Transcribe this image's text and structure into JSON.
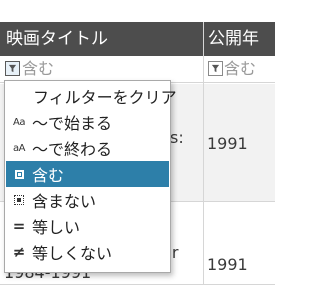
{
  "grid": {
    "columns": [
      {
        "header": "映画タイトル",
        "filter_placeholder": "含む"
      },
      {
        "header": "公開年",
        "filter_placeholder": "含む"
      }
    ],
    "rows": [
      {
        "title_fragment": "s:",
        "year": "1991"
      },
      {
        "title_fragment": "er",
        "title_fragment_2": "1984-1991",
        "year": "1991"
      }
    ]
  },
  "filter_menu": {
    "items": [
      {
        "label": "フィルターをクリア",
        "icon": "",
        "selected": false
      },
      {
        "label": "〜で始まる",
        "icon": "Aa",
        "selected": false
      },
      {
        "label": "〜で終わる",
        "icon": "aA",
        "selected": false
      },
      {
        "label": "含む",
        "icon": "contains-icon",
        "selected": true
      },
      {
        "label": "含まない",
        "icon": "not-contains-icon",
        "selected": false
      },
      {
        "label": "等しい",
        "icon": "=",
        "selected": false
      },
      {
        "label": "等しくない",
        "icon": "≠",
        "selected": false
      }
    ]
  },
  "colors": {
    "header_bg": "#4d4d4d",
    "selected_item_bg": "#2d7fa9",
    "alt_row_bg": "#f2f2f2"
  }
}
